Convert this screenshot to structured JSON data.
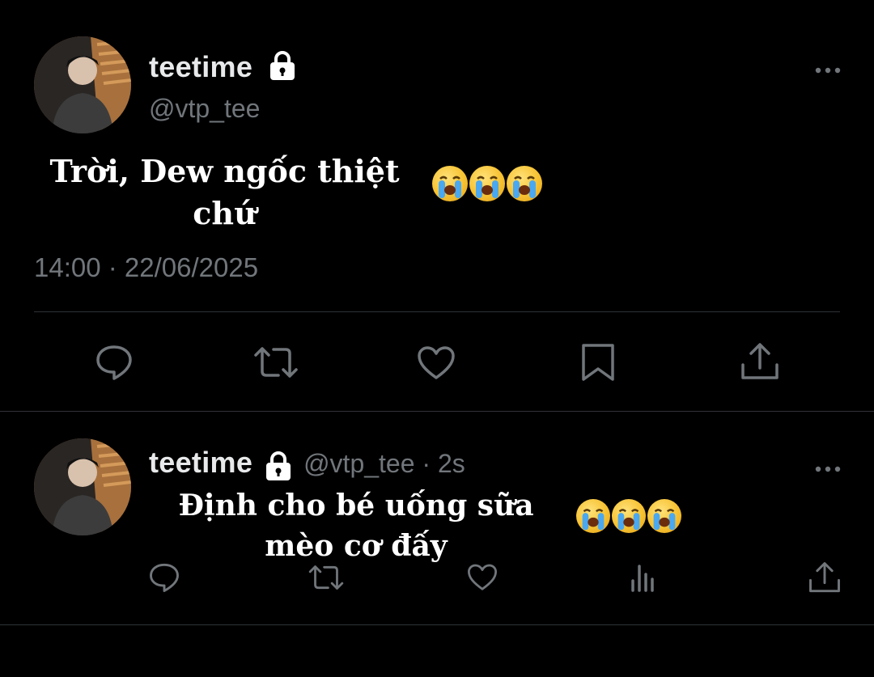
{
  "tweet_main": {
    "display_name": "teetime",
    "handle": "@vtp_tee",
    "text_line1": "Trời, Dew ngốc thiệt",
    "text_line2": "chứ",
    "timestamp": "14:00 · 22/06/2025",
    "icons": [
      "reply-icon",
      "retweet-icon",
      "like-icon",
      "bookmark-icon",
      "share-icon"
    ]
  },
  "tweet_reply": {
    "display_name": "teetime",
    "handle": "@vtp_tee · 2s",
    "text_line1": "Định cho bé uống sữa",
    "text_line2": "mèo cơ đấy",
    "icons": [
      "reply-icon",
      "retweet-icon",
      "like-icon",
      "views-icon",
      "share-icon"
    ]
  },
  "colors": {
    "background": "#000000",
    "text_primary": "#e7e9ea",
    "text_secondary": "#71767b",
    "divider": "#2f3336"
  }
}
